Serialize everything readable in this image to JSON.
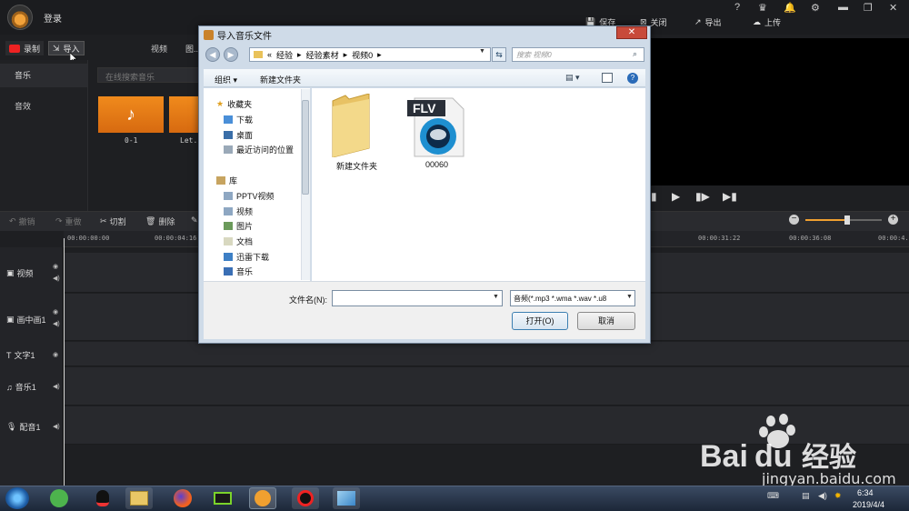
{
  "app": {
    "login_label": "登录",
    "save_label": "保存",
    "close_label": "关闭",
    "export_label": "导出",
    "upload_label": "上传",
    "record_label": "录制",
    "import_label": "导入",
    "media_tabs": [
      "视频",
      "图..."
    ],
    "categories": [
      "音乐",
      "音效"
    ],
    "search_placeholder": "在线搜索音乐",
    "tiles": [
      {
        "label": "0-1"
      },
      {
        "label": "Let..."
      }
    ]
  },
  "edit_toolbar": {
    "undo": "撤销",
    "redo": "重做",
    "cut": "切割",
    "delete": "删除"
  },
  "zoom_level": 0.55,
  "timeline": {
    "ticks": [
      "00:00:00:00",
      "00:00:04:16",
      "00:00:31:22",
      "00:00:36:08",
      "00:00:4..."
    ],
    "tracks": [
      "视频",
      "画中画1",
      "文字1",
      "音乐1",
      "配音1"
    ]
  },
  "dialog": {
    "title": "导入音乐文件",
    "close": "✕",
    "breadcrumb": [
      "«",
      "经验",
      "经验素材",
      "视频0"
    ],
    "search_placeholder": "搜索 视频0",
    "organize": "组织 ▾",
    "new_folder": "新建文件夹",
    "nav": {
      "favorites": "收藏夹",
      "downloads": "下载",
      "desktop": "桌面",
      "recent": "最近访问的位置",
      "libraries": "库",
      "pptv": "PPTV视频",
      "videos": "视频",
      "pictures": "图片",
      "documents": "文档",
      "thunder": "迅雷下载",
      "music": "音乐"
    },
    "files": [
      {
        "name": "新建文件夹",
        "icon": "folder-icon"
      },
      {
        "name": "00060",
        "icon": "flv-file-icon",
        "badge": "FLV"
      }
    ],
    "filename_label": "文件名(N):",
    "filename_value": "",
    "filetype_value": "音频(*.mp3 *.wma *.wav *.u8",
    "open_button": "打开(O)",
    "cancel_button": "取消"
  },
  "taskbar": {
    "time": "6:34",
    "date": "2019/4/4"
  },
  "watermark": {
    "brand": "Bai du 经验",
    "url": "jingyan.baidu.com"
  },
  "colors": {
    "accent": "#f0a030",
    "record": "#ee2222",
    "dialog_chrome": "#cfdbe8",
    "close_red": "#c84a3a"
  }
}
